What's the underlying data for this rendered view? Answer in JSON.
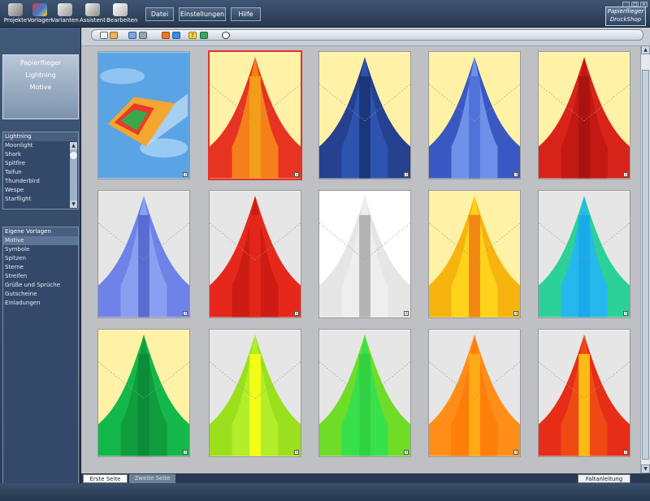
{
  "toolbar": {
    "projekte": "Projekte",
    "vorlagen": "Vorlagen",
    "varianten": "Varianten",
    "assistent": "Assistent",
    "bearbeiten": "Bearbeiten"
  },
  "menu": {
    "datei": "Datei",
    "einstellungen": "Einstellungen",
    "hilfe": "Hilfe"
  },
  "logo": {
    "line1": "Papierflieger",
    "line2": "DruckShop"
  },
  "category_box": {
    "line1": "Papierflieger",
    "line2": "Lightning",
    "line3": "Motive"
  },
  "model_list": {
    "header": "Lightning",
    "items": [
      "Moonlight",
      "Shark",
      "Spitfire",
      "Taifun",
      "Thunderbird",
      "Wespe",
      "Starflight"
    ]
  },
  "template_list": {
    "header": "Eigene Vorlagen",
    "items": [
      "Motive",
      "Symbole",
      "Spitzen",
      "Sterne",
      "Streifen",
      "Grüße und Sprüche",
      "Gutscheine",
      "Einladungen"
    ],
    "selected_index": 0
  },
  "bottom": {
    "tab1": "Erste Seite",
    "tab2": "Zweite Seite",
    "faltanleitung": "Faltanleitung"
  },
  "icons": {
    "toolbar": [
      "projekte-icon",
      "vorlagen-icon",
      "varianten-icon",
      "assistent-icon",
      "bearbeiten-icon"
    ],
    "iconbar": [
      "new-icon",
      "open-icon",
      "print-icon",
      "print-setup-icon",
      "paint-icon",
      "color-icon",
      "help-icon",
      "export-icon",
      "zoom-icon"
    ]
  },
  "thumbnails": [
    {
      "name": "plane-photo",
      "bg": "#5aa4e6",
      "type": "photo",
      "mid": "#f3a72f"
    },
    {
      "name": "red-sun",
      "bg": "#fff2a6",
      "type": "kite",
      "main": "#e63322",
      "mid": "#f57f1a",
      "stripe": "#f2a319",
      "selected": true
    },
    {
      "name": "blue-eagle",
      "bg": "#fff2a6",
      "type": "kite",
      "main": "#25418f",
      "mid": "#2c54b0",
      "stripe": "#173371"
    },
    {
      "name": "blue-rockets",
      "bg": "#fff2a6",
      "type": "kite",
      "main": "#3a58c2",
      "mid": "#6e90e8",
      "stripe": "#4c6fd6"
    },
    {
      "name": "red-zebra",
      "bg": "#fff2a6",
      "type": "kite",
      "main": "#d8231a",
      "mid": "#c41813",
      "stripe": "#a5140f"
    },
    {
      "name": "violet-jellyfish",
      "bg": "#e6e6e6",
      "type": "kite",
      "main": "#6e82e8",
      "mid": "#8b9ff0",
      "stripe": "#4f64c9"
    },
    {
      "name": "red-dark",
      "bg": "#e6e6e6",
      "type": "kite",
      "main": "#e6281c",
      "mid": "#cd1c13",
      "stripe": "#e6281c"
    },
    {
      "name": "white-jellyfish",
      "bg": "#ffffff",
      "type": "kite",
      "main": "#e6e6e6",
      "mid": "#eeeeee",
      "stripe": "#a8a8a8"
    },
    {
      "name": "yellow-leopard",
      "bg": "#fff2a6",
      "type": "kite",
      "main": "#f8b40e",
      "mid": "#ffd21c",
      "stripe": "#f07a10"
    },
    {
      "name": "teal-butterflies",
      "bg": "#e6e6e6",
      "type": "kite",
      "main": "#2bd198",
      "mid": "#24b8ee",
      "stripe": "#1aa7e6"
    },
    {
      "name": "green-zebra",
      "bg": "#fff2a6",
      "type": "kite",
      "main": "#14b84a",
      "mid": "#0f9d3d",
      "stripe": "#0c8a35"
    },
    {
      "name": "lime-leopard",
      "bg": "#e6e6e6",
      "type": "kite",
      "main": "#9be01c",
      "mid": "#b2ee2a",
      "stripe": "#ffff14"
    },
    {
      "name": "lime-butterflies",
      "bg": "#e6e6e6",
      "type": "kite",
      "main": "#6fdc27",
      "mid": "#38e04c",
      "stripe": "#2fcf41"
    },
    {
      "name": "orange-butterflies",
      "bg": "#e6e6e6",
      "type": "kite",
      "main": "#ff8e18",
      "mid": "#ff7e0a",
      "stripe": "#ffb21a"
    },
    {
      "name": "red-butterflies",
      "bg": "#e6e6e6",
      "type": "kite",
      "main": "#e62d17",
      "mid": "#f04a14",
      "stripe": "#ffcc14"
    }
  ]
}
